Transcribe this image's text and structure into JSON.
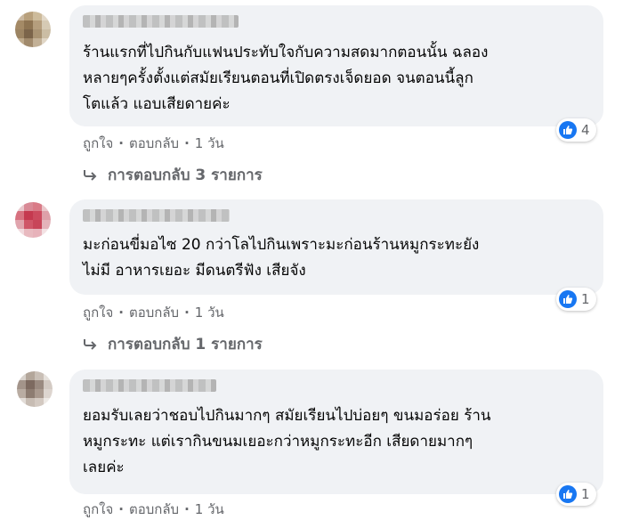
{
  "colors": {
    "bubble": "#f0f2f5",
    "meta_text": "#65676b",
    "like_blue": "#1877f2"
  },
  "comments": [
    {
      "text": "ร้านแรกที่ไปกินกับแฟนประทับใจกับความสดมากตอนนั้น ฉลอง\nหลายๆครั้งตั้งแต่สมัยเรียนตอนที่เปิดตรงเจ็ดยอด จนตอนนี้ลูก\nโตแล้ว แอบเสียดายค่ะ",
      "like_count": "4",
      "like_label": "ถูกใจ",
      "reply_label": "ตอบกลับ",
      "time": "1 วัน",
      "replies_label": "การตอบกลับ 3 รายการ",
      "avatar_icon": "pixelated-avatar-icon"
    },
    {
      "text": "มะก่อนขี่มอไซ 20 กว่าโลไปกินเพราะมะก่อนร้านหมูกระทะยัง\nไม่มี อาหารเยอะ มีดนตรีฟัง เสียจัง",
      "like_count": "1",
      "like_label": "ถูกใจ",
      "reply_label": "ตอบกลับ",
      "time": "1 วัน",
      "replies_label": "การตอบกลับ 1 รายการ",
      "avatar_icon": "pixelated-avatar-icon"
    },
    {
      "text": "ยอมรับเลยว่าชอบไปกินมากๆ สมัยเรียนไปบ่อยๆ ขนมอร่อย ร้าน\nหมูกระทะ แต่เรากินขนมเยอะกว่าหมูกระทะอีก เสียดายมากๆ\nเลยค่ะ",
      "like_count": "1",
      "like_label": "ถูกใจ",
      "reply_label": "ตอบกลับ",
      "time": "1 วัน",
      "avatar_icon": "pixelated-avatar-icon"
    }
  ]
}
